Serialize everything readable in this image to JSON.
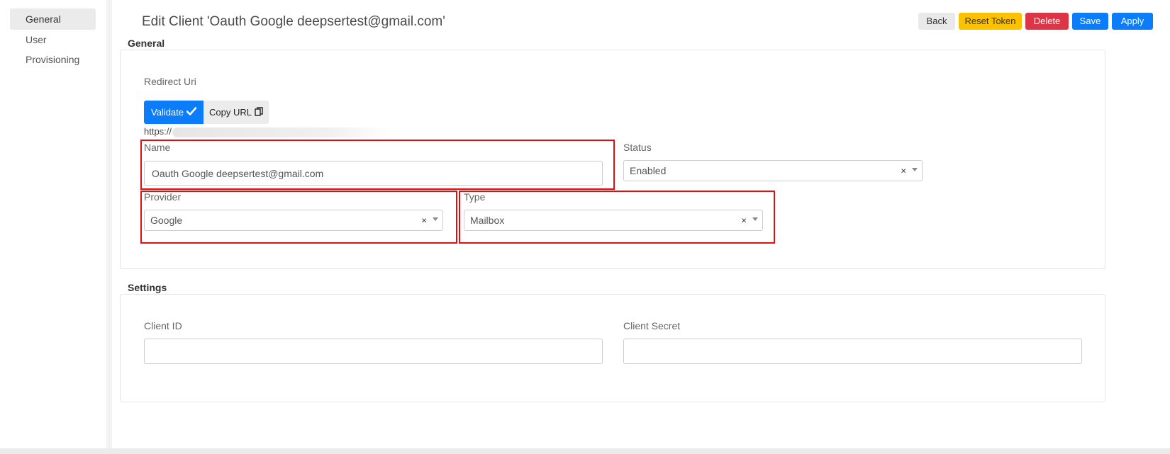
{
  "sidebar": {
    "items": [
      {
        "label": "General",
        "active": true
      },
      {
        "label": "User",
        "active": false
      },
      {
        "label": "Provisioning",
        "active": false
      }
    ]
  },
  "header": {
    "title": "Edit Client 'Oauth Google deepsertest@gmail.com'",
    "buttons": {
      "back": "Back",
      "reset_token": "Reset Token",
      "delete": "Delete",
      "save": "Save",
      "apply": "Apply"
    }
  },
  "general": {
    "section_title": "General",
    "redirect_uri": {
      "label": "Redirect Uri",
      "validate_label": "Validate",
      "copy_label": "Copy URL",
      "value": "https://"
    },
    "name": {
      "label": "Name",
      "value": "Oauth Google deepsertest@gmail.com"
    },
    "status": {
      "label": "Status",
      "value": "Enabled"
    },
    "provider": {
      "label": "Provider",
      "value": "Google"
    },
    "type": {
      "label": "Type",
      "value": "Mailbox"
    }
  },
  "settings": {
    "section_title": "Settings",
    "client_id": {
      "label": "Client ID",
      "value": ""
    },
    "client_secret": {
      "label": "Client Secret",
      "value": ""
    }
  },
  "colors": {
    "primary": "#0b7dfb",
    "warning": "#fcc200",
    "danger": "#dc3545",
    "highlight": "#e01010"
  },
  "icons": {
    "validate": "check-icon",
    "copy": "copy-icon",
    "clear": "clear-icon",
    "dropdown": "chevron-down-icon"
  }
}
